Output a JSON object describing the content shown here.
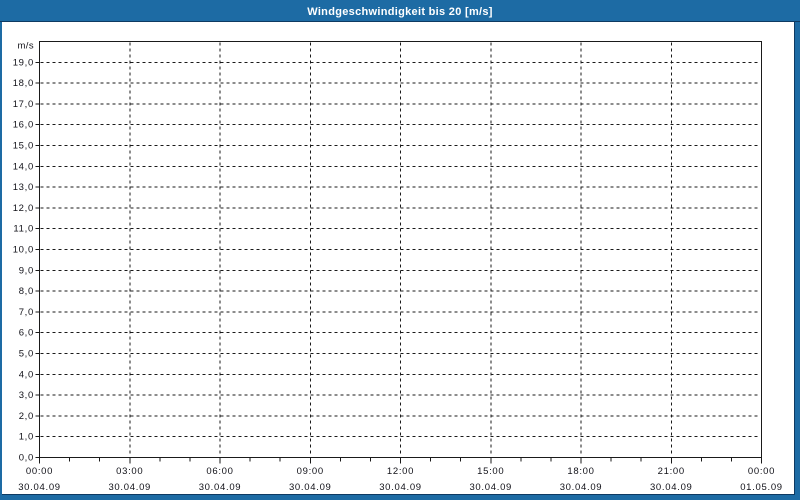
{
  "window": {
    "title": "Windgeschwindigkeit bis 20 [m/s]"
  },
  "colors": {
    "frame": "#1d6ba4",
    "frame_edge": "#0e3a62",
    "title_text": "#ffffff",
    "plot_background": "#ffffff",
    "axis": "#1a1a1a",
    "grid": "#1a1a1a",
    "label_text": "#111118"
  },
  "chart_data": {
    "type": "line",
    "title": "Windgeschwindigkeit bis 20 [m/s]",
    "xlabel": "",
    "ylabel": "m/s",
    "grid": "dashed",
    "legend_position": "none",
    "y_axis": {
      "unit": "m/s",
      "min": 0,
      "max": 20,
      "tick_step": 1.0,
      "tick_labels": [
        "0,0",
        "1,0",
        "2,0",
        "3,0",
        "4,0",
        "5,0",
        "6,0",
        "7,0",
        "8,0",
        "9,0",
        "10,0",
        "11,0",
        "12,0",
        "13,0",
        "14,0",
        "15,0",
        "16,0",
        "17,0",
        "18,0",
        "19,0"
      ],
      "grid_style": "dashed"
    },
    "x_axis": {
      "span_hours": 24,
      "minor_tick_every_hours": 1,
      "major_tick_every_hours": 3,
      "major_ticks": [
        {
          "time": "00:00",
          "date": "30.04.09"
        },
        {
          "time": "03:00",
          "date": "30.04.09"
        },
        {
          "time": "06:00",
          "date": "30.04.09"
        },
        {
          "time": "09:00",
          "date": "30.04.09"
        },
        {
          "time": "12:00",
          "date": "30.04.09"
        },
        {
          "time": "15:00",
          "date": "30.04.09"
        },
        {
          "time": "18:00",
          "date": "30.04.09"
        },
        {
          "time": "21:00",
          "date": "30.04.09"
        },
        {
          "time": "00:00",
          "date": "01.05.09"
        }
      ],
      "grid_style": "dashed"
    },
    "series": []
  }
}
